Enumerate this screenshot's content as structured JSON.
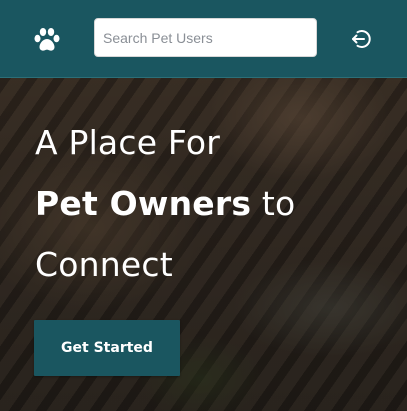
{
  "navbar": {
    "logo_icon": "paw-icon",
    "search": {
      "placeholder": "Search Pet Users",
      "value": ""
    },
    "logout_icon": "logout-icon"
  },
  "hero": {
    "heading": {
      "line1": "A Place For",
      "line2_bold": "Pet Owners",
      "line2_rest": " to",
      "line3": "Connect"
    },
    "cta_label": "Get Started",
    "background_description": "dark photo of a tabby cat"
  },
  "colors": {
    "navbar_bg": "#1a5660",
    "button_bg": "#1a5660",
    "heading_text": "#ffffff",
    "search_bg": "#ffffff"
  }
}
